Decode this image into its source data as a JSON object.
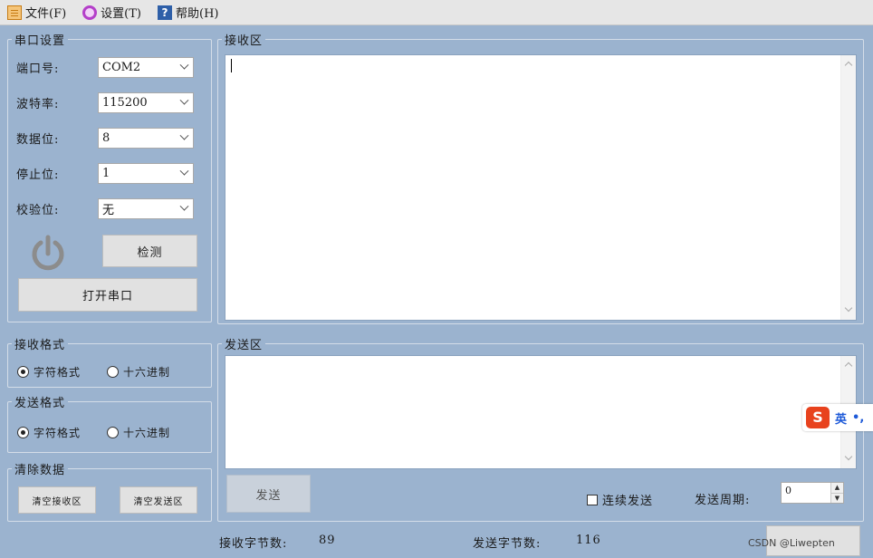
{
  "menu": [
    {
      "label": "文件(F)",
      "icon": "file-icon"
    },
    {
      "label": "设置(T)",
      "icon": "gear-icon"
    },
    {
      "label": "帮助(H)",
      "icon": "help-icon"
    }
  ],
  "serial": {
    "title": "串口设置",
    "fields": [
      {
        "label": "端口号:",
        "value": "COM2"
      },
      {
        "label": "波特率:",
        "value": "115200"
      },
      {
        "label": "数据位:",
        "value": "8"
      },
      {
        "label": "停止位:",
        "value": "1"
      },
      {
        "label": "校验位:",
        "value": "无"
      }
    ],
    "detect_label": "检测",
    "open_label": "打开串口",
    "power_color": "#8c8c8c"
  },
  "receive_format": {
    "title": "接收格式",
    "options": [
      "字符格式",
      "十六进制"
    ],
    "selected": 0
  },
  "send_format": {
    "title": "发送格式",
    "options": [
      "字符格式",
      "十六进制"
    ],
    "selected": 0
  },
  "clear": {
    "title": "清除数据",
    "clear_receive_label": "清空接收区",
    "clear_send_label": "清空发送区"
  },
  "receive_area": {
    "title": "接收区",
    "content": ""
  },
  "send_area": {
    "title": "发送区",
    "content": ""
  },
  "send_controls": {
    "send_label": "发送",
    "continuous_label": "连续发送",
    "period_label": "发送周期:",
    "period_value": "0"
  },
  "stats": {
    "received_label": "接收字节数:",
    "received_value": "89",
    "sent_label": "发送字节数:",
    "sent_value": "116"
  },
  "ime": {
    "language": "英",
    "logo": "S",
    "extra": "•,"
  },
  "watermark": "CSDN @Liwepten",
  "colors": {
    "background": "#9bb3cf",
    "button": "#e1e1e1",
    "ime_logo": "#e8421d"
  }
}
